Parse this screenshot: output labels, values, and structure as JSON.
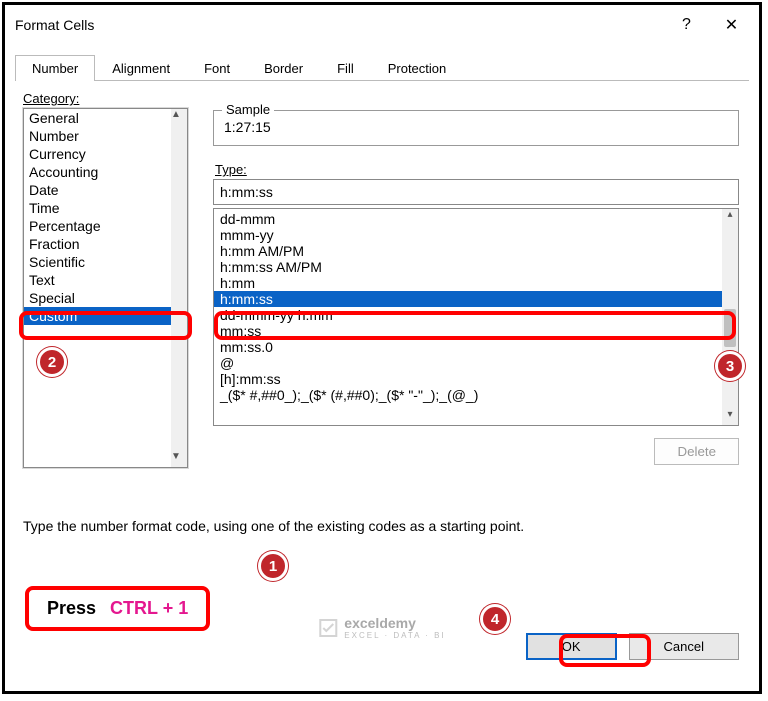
{
  "dialog": {
    "title": "Format Cells"
  },
  "titlebar": {
    "help": "?",
    "close": "✕"
  },
  "tabs": [
    "Number",
    "Alignment",
    "Font",
    "Border",
    "Fill",
    "Protection"
  ],
  "active_tab": 0,
  "labels": {
    "category": "Category:",
    "sample": "Sample",
    "type": "Type:"
  },
  "categories": [
    "General",
    "Number",
    "Currency",
    "Accounting",
    "Date",
    "Time",
    "Percentage",
    "Fraction",
    "Scientific",
    "Text",
    "Special",
    "Custom"
  ],
  "selected_category": "Custom",
  "sample_value": "1:27:15",
  "type_input": "h:mm:ss",
  "type_options": [
    "dd-mmm",
    "mmm-yy",
    "h:mm AM/PM",
    "h:mm:ss AM/PM",
    "h:mm",
    "h:mm:ss",
    "dd-mmm-yy h:mm",
    "mm:ss",
    "mm:ss.0",
    "@",
    "[h]:mm:ss",
    "_($* #,##0_);_($* (#,##0);_($* \"-\"_);_(@_)"
  ],
  "selected_type": "h:mm:ss",
  "buttons": {
    "delete": "Delete",
    "ok": "OK",
    "cancel": "Cancel"
  },
  "hint_text": "Type the number format code, using one of the existing codes as a starting point.",
  "annotations": {
    "press_label": "Press",
    "keys": "CTRL + 1",
    "badge1": "1",
    "badge2": "2",
    "badge3": "3",
    "badge4": "4"
  },
  "watermark": {
    "name": "exceldemy",
    "sub": "EXCEL · DATA · BI"
  }
}
